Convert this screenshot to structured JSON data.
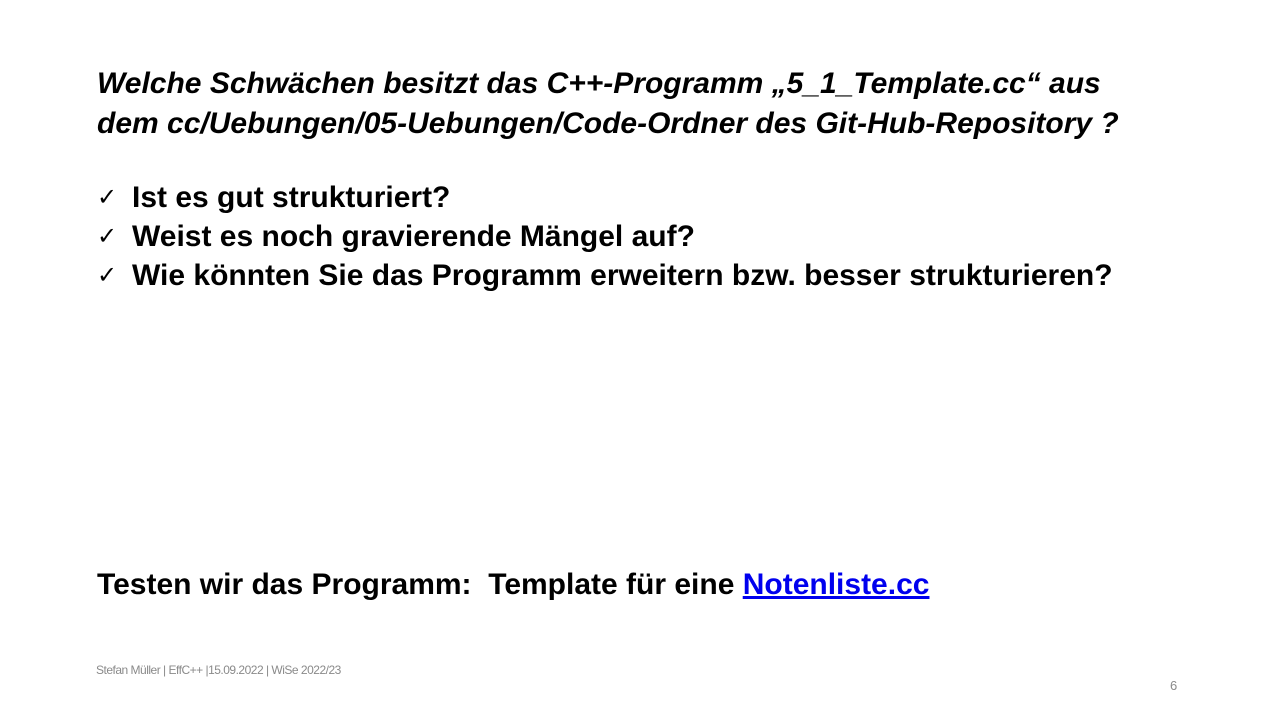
{
  "title": {
    "line1": "Welche Schwächen besitzt das C++-Programm „5_1_Template.cc“ aus",
    "line2": "dem cc/Uebungen/05-Uebungen/Code-Ordner des Git-Hub-Repository ?"
  },
  "bullets": [
    {
      "icon": "checkmark-icon",
      "glyph": "✓",
      "text": "Ist es gut strukturiert?"
    },
    {
      "icon": "checkmark-icon",
      "glyph": "✓",
      "text": "Weist es noch gravierende Mängel auf?"
    },
    {
      "icon": "checkmark-icon",
      "glyph": "✓",
      "text": "Wie könnten Sie das Programm erweitern bzw. besser strukturieren?"
    }
  ],
  "test": {
    "prefix": "Testen wir das Programm:  Template für eine ",
    "link": "Notenliste.cc",
    "link_color": "#0000ee"
  },
  "footer": "Stefan Müller | EffC++ |15.09.2022 | WiSe 2022/23",
  "page_number": "6"
}
